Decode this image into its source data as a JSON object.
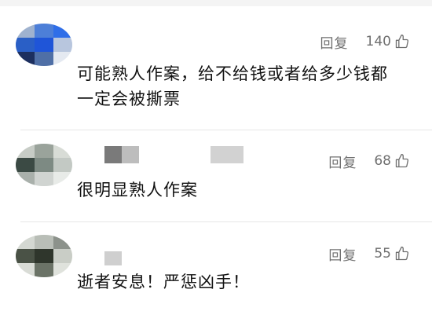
{
  "comments": [
    {
      "reply_label": "回复",
      "like_count": "140",
      "text_line1": "可能熟人作案，给不给钱或者给多少钱都",
      "text_line2": "一定会被撕票"
    },
    {
      "reply_label": "回复",
      "like_count": "68",
      "text_line1": "很明显熟人作案"
    },
    {
      "reply_label": "回复",
      "like_count": "55",
      "text_line1": "逝者安息！严惩凶手！"
    }
  ],
  "icons": {
    "like": "thumbs-up-icon",
    "avatar": "avatar"
  },
  "colors": {
    "meta_text": "#6f6f6f",
    "body_text": "#111111",
    "divider": "#e6e6e6"
  }
}
